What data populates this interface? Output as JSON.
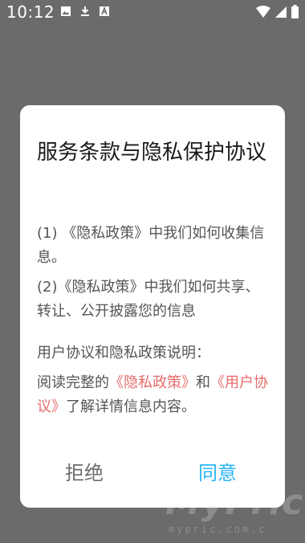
{
  "status_bar": {
    "time": "10:12",
    "left_icons": [
      "image-icon",
      "download-icon",
      "text-icon"
    ],
    "right_icons": [
      "wifi-icon",
      "signal-icon",
      "battery-icon"
    ]
  },
  "dialog": {
    "title": "服务条款与隐私保护协议",
    "item1": "(1) 《隐私政策》中我们如何收集信息。",
    "item2": "(2)《隐私政策》中我们如何共享、转让、公开披露您的信息",
    "note": "用户协议和隐私政策说明：",
    "read_prefix": "阅读完整的",
    "privacy_link": "《隐私政策》",
    "and_text": "和",
    "agreement_link": "《用户协议》",
    "read_suffix": "了解详情信息内容。",
    "reject_label": "拒绝",
    "agree_label": "同意"
  },
  "watermark": {
    "main": "MyPric",
    "sub": "mypric.com.c"
  },
  "colors": {
    "overlay": "#6b6b6b",
    "link": "#e86b6b",
    "agree": "#29b6f6",
    "reject": "#6d6d6d"
  }
}
